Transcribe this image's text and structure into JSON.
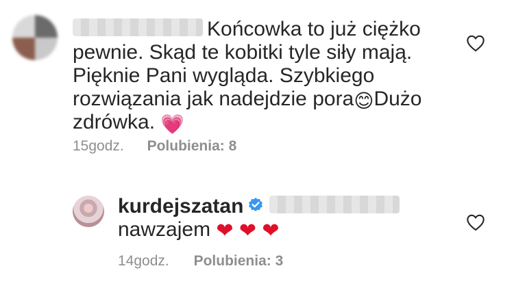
{
  "comments": [
    {
      "text_lines": [
        "Końcowka to już ciężko",
        "pewnie. Skąd te kobitki tyle siły mają.",
        "Pięknie Pani wygląda. Szybkiego",
        "rozwiązania jak nadejdzie pora",
        "Dużo",
        "zdrówka."
      ],
      "emoji_smile": "😊",
      "emoji_heart": "💗",
      "time": "15godz.",
      "likes": "Polubienia: 8"
    }
  ],
  "reply": {
    "username": "kurdejszatan",
    "text": "nawzajem",
    "hearts": [
      "❤",
      "❤",
      "❤"
    ],
    "time": "14godz.",
    "likes": "Polubienia: 3"
  },
  "colors": {
    "text": "#262626",
    "meta": "#8e8e8e",
    "verified": "#3897f0",
    "heart_red": "#e0102a"
  },
  "icons": [
    "heart-outline-icon",
    "verified-badge-icon"
  ]
}
